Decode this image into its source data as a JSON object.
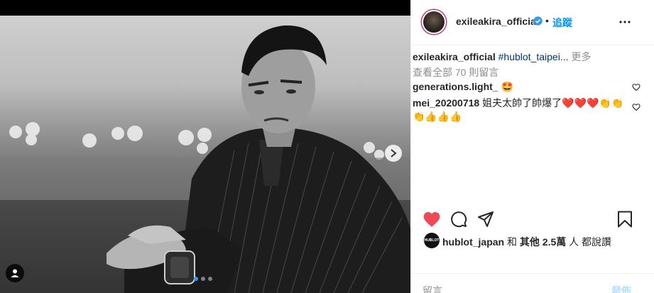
{
  "post": {
    "username": "exileakira_official",
    "separator": "•",
    "follow_label": "追蹤"
  },
  "caption": {
    "username": "exileakira_official",
    "hashtag": "#hublot_taipei...",
    "more": "更多"
  },
  "view_all": "查看全部 70 則留言",
  "comments": [
    {
      "username": "generations.light_",
      "text": "🤩"
    },
    {
      "username": "mei_20200718",
      "text": "姐夫太帥了帥爆了❤️❤️❤️👏👏👏👍👍👍"
    }
  ],
  "likes": {
    "avatar_text": "HUBLOT",
    "username": "hublot_japan",
    "and": "和",
    "others": "其他",
    "count": "2.5萬",
    "suffix": "人 都說讚"
  },
  "add_comment": {
    "placeholder": "留言……",
    "post_label": "發佈"
  },
  "carousel": {
    "slides": 3,
    "active_index": 0
  },
  "colors": {
    "accent": "#0095f6",
    "like_red": "#ed4956",
    "hashtag": "#00376b"
  }
}
